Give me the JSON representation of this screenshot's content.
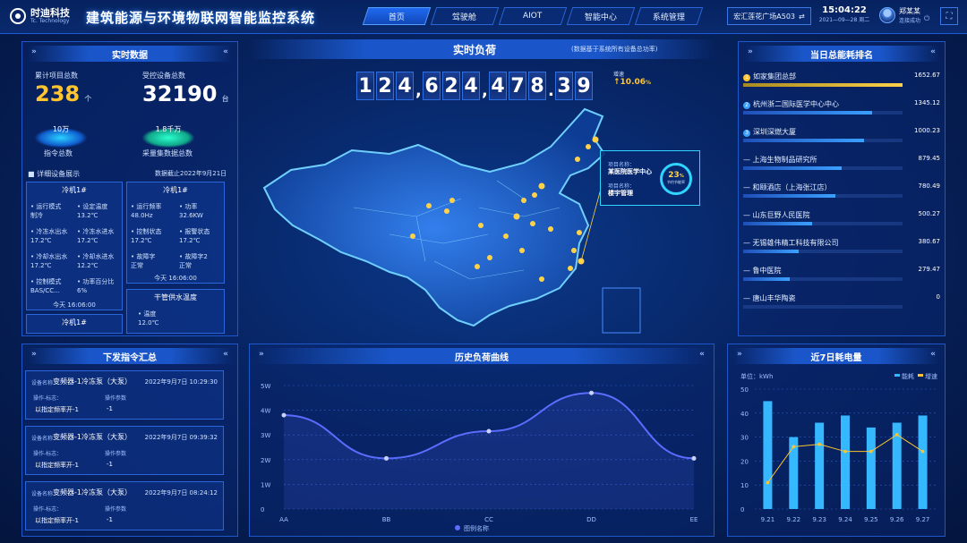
{
  "header": {
    "logo_text": "时迪科技",
    "logo_sub": "Tc. Technology",
    "title": "建筑能源与环境物联网智能监控系统",
    "nav": [
      "首页",
      "驾驶舱",
      "AIOT",
      "智能中心",
      "系统管理"
    ],
    "location": "宏汇莲花广场A503",
    "time": "15:04:22",
    "date": "2021—09—28 周二",
    "user_name": "郑某某",
    "user_status": "连接成功"
  },
  "realtime": {
    "title": "实时数据",
    "total_projects_label": "累计项目总数",
    "total_projects": "238",
    "total_projects_unit": "个",
    "controlled_devices_label": "受控设备总数",
    "controlled_devices": "32190",
    "controlled_devices_unit": "台",
    "cmd_total_value": "10万",
    "cmd_total_label": "指令总数",
    "collect_total_value": "1.8千万",
    "collect_total_label": "采量集数据总数",
    "detail_label": "详细设备展示",
    "detail_date": "数据截止2022年9月21日",
    "card1": {
      "title": "冷机1#",
      "items": [
        {
          "k": "运行模式",
          "v": "制冷"
        },
        {
          "k": "设定温度",
          "v": "13.2℃"
        },
        {
          "k": "冷冻水出水",
          "v": "17.2℃"
        },
        {
          "k": "冷冻水进水",
          "v": "17.2℃"
        },
        {
          "k": "冷却水出水",
          "v": "17.2℃"
        },
        {
          "k": "冷却水进水",
          "v": "12.2℃"
        },
        {
          "k": "控制模式",
          "v": "BAS/CC..."
        },
        {
          "k": "功率百分比",
          "v": "6%"
        }
      ],
      "footer": "今天 16:06:00"
    },
    "card2": {
      "title": "冷机1#",
      "items": [
        {
          "k": "运行频率",
          "v": "48.0Hz"
        },
        {
          "k": "功率",
          "v": "32.6KW"
        },
        {
          "k": "控制状态",
          "v": "17.2℃"
        },
        {
          "k": "报警状态",
          "v": "17.2℃"
        },
        {
          "k": "故障字",
          "v": "正常"
        },
        {
          "k": "故障字2",
          "v": "正常"
        }
      ],
      "footer": "今天 16:06:00"
    },
    "card3": {
      "title": "干管供水温度",
      "items": [
        {
          "k": "温度",
          "v": "12.0℃"
        }
      ]
    },
    "card4": {
      "title": "冷机1#"
    }
  },
  "center": {
    "title": "实时负荷",
    "subtitle": "(数据基于系统所有设备总功率)",
    "digits": [
      "1",
      "2",
      "4",
      ",",
      "6",
      "2",
      "4",
      ",",
      "4",
      "7",
      "8",
      ".",
      "3",
      "9"
    ],
    "growth_label": "增速",
    "growth_value": "10.06",
    "growth_unit": "%",
    "callout": {
      "k1": "项目名称：",
      "v1": "某医院医学中心",
      "k2": "项目名称：",
      "v2": "楼宇管理",
      "percent": "23",
      "percent_unit": "%",
      "percent_label": "节约节能率"
    }
  },
  "ranking": {
    "title": "当日总能耗排名",
    "items": [
      {
        "rank": "1",
        "name": "如家集团总部",
        "value": "1652.67",
        "ratio": 1.0
      },
      {
        "rank": "2",
        "name": "杭州浙二国际医学中心中心",
        "value": "1345.12",
        "ratio": 0.81
      },
      {
        "rank": "3",
        "name": "深圳深燃大厦",
        "value": "1000.23",
        "ratio": 0.76
      },
      {
        "rank": "",
        "name": "上海生物制品研究所",
        "value": "879.45",
        "ratio": 0.62
      },
      {
        "rank": "",
        "name": "和颐酒店（上海张江店）",
        "value": "780.49",
        "ratio": 0.58
      },
      {
        "rank": "",
        "name": "山东巨野人民医院",
        "value": "500.27",
        "ratio": 0.43
      },
      {
        "rank": "",
        "name": "无锡雄伟精工科技有限公司",
        "value": "380.67",
        "ratio": 0.35
      },
      {
        "rank": "",
        "name": "鲁中医院",
        "value": "279.47",
        "ratio": 0.29
      },
      {
        "rank": "",
        "name": "唐山丰华陶瓷",
        "value": "0",
        "ratio": 0.0
      }
    ]
  },
  "commands": {
    "title": "下发指令汇总",
    "items": [
      {
        "device_label": "设备名称",
        "device": "变频器-1冷冻泵（大泵）",
        "time": "2022年9月7日   10:29:30",
        "op_label": "操作-标志：",
        "op": "以指定频率开-1",
        "param_label": "操作参数",
        "param": "-1"
      },
      {
        "device_label": "设备名称",
        "device": "变频器-1冷冻泵（大泵）",
        "time": "2022年9月7日   09:39:32",
        "op_label": "操作-标志：",
        "op": "以指定频率开-1",
        "param_label": "操作参数",
        "param": "-1"
      },
      {
        "device_label": "设备名称",
        "device": "变频器-1冷冻泵（大泵）",
        "time": "2022年9月7日   08:24:12",
        "op_label": "操作-标志：",
        "op": "以指定频率开-1",
        "param_label": "操作参数",
        "param": "-1"
      }
    ]
  },
  "colors": {
    "accent": "#1a56c9",
    "line": "#5b6cff",
    "bar": "#35b8ff",
    "growth": "#ffc42e"
  },
  "chart_data": [
    {
      "type": "line",
      "title": "历史负荷曲线",
      "categories": [
        "AA",
        "BB",
        "CC",
        "DD",
        "EE"
      ],
      "y_ticks": [
        "0",
        "1W",
        "2W",
        "3W",
        "4W",
        "5W"
      ],
      "series": [
        {
          "name": "图例名称",
          "values": [
            38000,
            20500,
            31500,
            47000,
            20500
          ]
        }
      ],
      "ylim": [
        0,
        50000
      ]
    },
    {
      "type": "bar",
      "title": "近7日耗电量",
      "unit_label": "单位：kWh",
      "categories": [
        "9.21",
        "9.22",
        "9.23",
        "9.24",
        "9.25",
        "9.26",
        "9.27"
      ],
      "y_ticks": [
        "0",
        "10",
        "20",
        "30",
        "40",
        "50"
      ],
      "series": [
        {
          "name": "能耗",
          "type": "bar",
          "values": [
            45,
            30,
            36,
            39,
            34,
            36,
            39
          ]
        },
        {
          "name": "增速",
          "type": "line",
          "values": [
            11,
            26,
            27,
            24,
            24,
            31,
            24
          ]
        }
      ],
      "ylim": [
        0,
        50
      ]
    }
  ]
}
